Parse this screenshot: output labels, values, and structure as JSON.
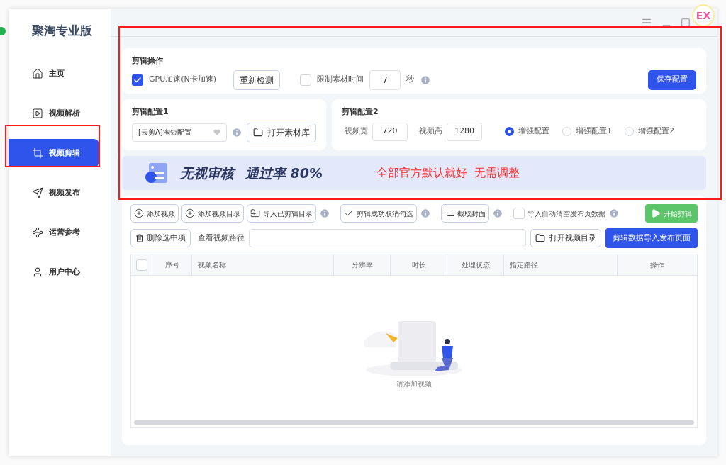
{
  "app": {
    "title": "聚淘专业版"
  },
  "badge": "EX",
  "sidebar": {
    "items": [
      {
        "label": "主页",
        "selected": false
      },
      {
        "label": "视频解析",
        "selected": false
      },
      {
        "label": "视频剪辑",
        "selected": true
      },
      {
        "label": "视频发布",
        "selected": false
      },
      {
        "label": "运营参考",
        "selected": false
      },
      {
        "label": "用户中心",
        "selected": false
      }
    ]
  },
  "edit_ops": {
    "title": "剪辑操作",
    "gpu": {
      "label": "GPU加速(N卡加速)",
      "checked": true
    },
    "recheck_button": "重新检测",
    "limit": {
      "label": "限制素材时间",
      "checked": false
    },
    "limit_value": "7",
    "unit": "秒",
    "save_button": "保存配置"
  },
  "config1": {
    "title": "剪辑配置1",
    "select_value": "[云剪A]淘短配置",
    "open_button": "打开素材库"
  },
  "config2": {
    "title": "剪辑配置2",
    "width_label": "视频宽",
    "width_value": "720",
    "height_label": "视频高",
    "height_value": "1280",
    "options": [
      {
        "label": "增强配置",
        "selected": true
      },
      {
        "label": "增强配置1",
        "selected": false
      },
      {
        "label": "增强配置2",
        "selected": false
      }
    ]
  },
  "banner": {
    "headline": [
      "无视审核",
      "通过率 80%"
    ],
    "note": "全部官方默认就好  无需调整"
  },
  "toolbar": {
    "buttons": [
      {
        "label": "添加视频",
        "info": false
      },
      {
        "label": "添加视频目录",
        "info": false
      },
      {
        "label": "导入已剪辑目录",
        "info": true
      },
      {
        "label": "剪辑成功取消勾选",
        "info": true
      },
      {
        "label": "截取封面",
        "info": true
      }
    ],
    "auto_clear": {
      "label": "导入自动清空发布页数据",
      "checked": false
    },
    "start_button": "开始剪辑",
    "delete_button": "删除选中项",
    "path_label": "查看视频路径",
    "open_dir_button": "打开视频目录",
    "export_button": "剪辑数据导入发布页面"
  },
  "table": {
    "select_all": false,
    "columns": [
      "序号",
      "视频名称",
      "分辨率",
      "时长",
      "处理状态",
      "指定路径",
      "操作"
    ],
    "empty_text": "请添加视频"
  }
}
